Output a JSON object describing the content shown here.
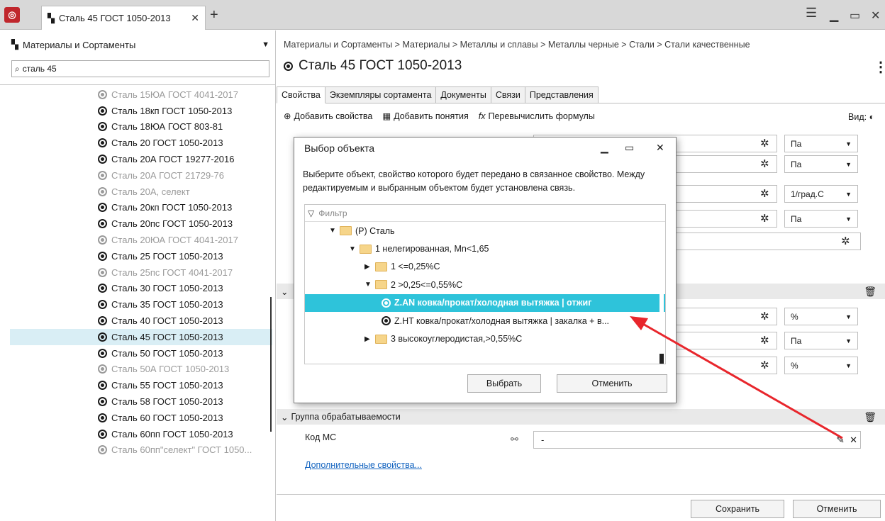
{
  "app": {
    "tab_title": "Сталь 45 ГОСТ 1050-2013"
  },
  "left": {
    "library": "Материалы и Сортаменты",
    "search_value": "сталь 45",
    "items": [
      {
        "label": "Сталь 15ЮА ГОСТ 4041-2017",
        "dim": true
      },
      {
        "label": "Сталь 18кп ГОСТ 1050-2013",
        "dim": false
      },
      {
        "label": "Сталь 18ЮА ГОСТ 803-81",
        "dim": false
      },
      {
        "label": "Сталь 20 ГОСТ 1050-2013",
        "dim": false
      },
      {
        "label": "Сталь 20А ГОСТ 19277-2016",
        "dim": false
      },
      {
        "label": "Сталь 20А ГОСТ 21729-76",
        "dim": true
      },
      {
        "label": "Сталь 20А, селект",
        "dim": true
      },
      {
        "label": "Сталь 20кп ГОСТ 1050-2013",
        "dim": false
      },
      {
        "label": "Сталь 20пс ГОСТ 1050-2013",
        "dim": false
      },
      {
        "label": "Сталь 20ЮА ГОСТ 4041-2017",
        "dim": true
      },
      {
        "label": "Сталь 25 ГОСТ 1050-2013",
        "dim": false
      },
      {
        "label": "Сталь 25пс ГОСТ 4041-2017",
        "dim": true
      },
      {
        "label": "Сталь 30 ГОСТ 1050-2013",
        "dim": false
      },
      {
        "label": "Сталь 35 ГОСТ 1050-2013",
        "dim": false
      },
      {
        "label": "Сталь 40 ГОСТ 1050-2013",
        "dim": false
      },
      {
        "label": "Сталь 45 ГОСТ 1050-2013",
        "dim": false,
        "selected": true
      },
      {
        "label": "Сталь 50 ГОСТ 1050-2013",
        "dim": false
      },
      {
        "label": "Сталь 50А ГОСТ 1050-2013",
        "dim": true
      },
      {
        "label": "Сталь 55 ГОСТ 1050-2013",
        "dim": false
      },
      {
        "label": "Сталь 58 ГОСТ 1050-2013",
        "dim": false
      },
      {
        "label": "Сталь 60 ГОСТ 1050-2013",
        "dim": false
      },
      {
        "label": "Сталь 60пп ГОСТ 1050-2013",
        "dim": false
      },
      {
        "label": "Сталь 60пп\"селект\" ГОСТ 1050...",
        "dim": true
      }
    ]
  },
  "main": {
    "breadcrumb": "Материалы и Сортаменты > Материалы > Металлы и сплавы > Металлы черные > Стали > Стали качественные",
    "title": "Сталь 45 ГОСТ 1050-2013",
    "tabs": [
      "Свойства",
      "Экземпляры сортамента",
      "Документы",
      "Связи",
      "Представления"
    ],
    "toolbar": {
      "add_props": "Добавить свойства",
      "add_concepts": "Добавить понятия",
      "recalc": "Перевычислить формулы",
      "view": "Вид:"
    },
    "units": [
      "Па",
      "Па",
      "1/град.С",
      "Па",
      "%",
      "Па",
      "%"
    ],
    "section2": "Группа обрабатываемости",
    "code_label": "Код МС",
    "code_value": "-",
    "more_link": "Дополнительные свойства...",
    "save": "Сохранить",
    "cancel": "Отменить"
  },
  "dialog": {
    "title": "Выбор объекта",
    "text": "Выберите объект, свойство которого будет передано в связанное свойство. Между редактируемым и выбранным объектом будет установлена связь.",
    "filter_placeholder": "Фильтр",
    "tree": [
      {
        "label": "(Р) Сталь",
        "level": 0,
        "type": "folder",
        "expanded": true
      },
      {
        "label": "1 нелегированная, Mn<1,65",
        "level": 1,
        "type": "folder",
        "expanded": true
      },
      {
        "label": "1 <=0,25%С",
        "level": 2,
        "type": "folder",
        "expanded": false
      },
      {
        "label": "2 >0,25<=0,55%С",
        "level": 2,
        "type": "folder",
        "expanded": true
      },
      {
        "label": "Z.AN ковка/прокат/холодная вытяжка | отжиг",
        "level": 3,
        "type": "item",
        "selected": true
      },
      {
        "label": "Z.HT ковка/прокат/холодная вытяжка | закалка + в...",
        "level": 3,
        "type": "item"
      },
      {
        "label": "3 высокоуглеродистая,>0,55%С",
        "level": 2,
        "type": "folder",
        "expanded": false
      }
    ],
    "select_btn": "Выбрать",
    "cancel_btn": "Отменить"
  },
  "colors": {
    "accent": "#2ec3da",
    "arrow": "#e8262c",
    "selected_row": "#d9eef5",
    "logo": "#c0272d"
  }
}
